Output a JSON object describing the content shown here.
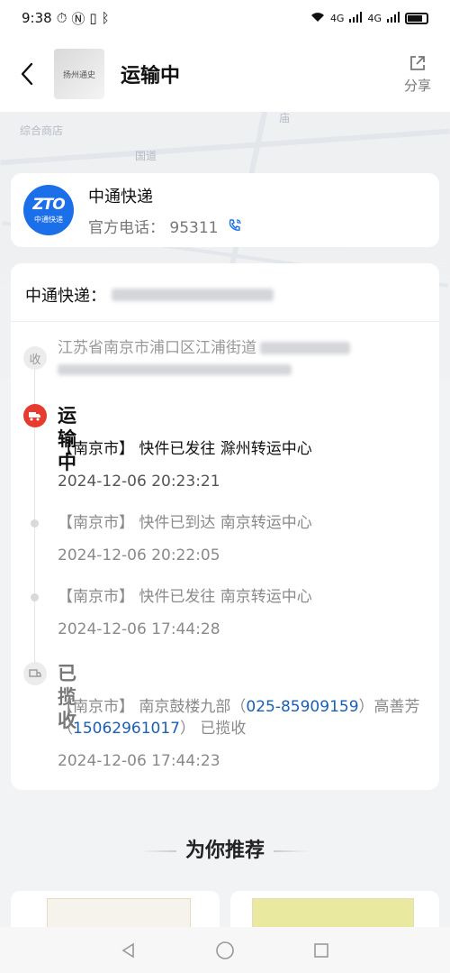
{
  "status_bar": {
    "time": "9:38",
    "network_1": "4G",
    "network_2": "4G"
  },
  "header": {
    "thumb_text": "扬州通史",
    "title": "运输中",
    "share_label": "分享"
  },
  "map": {
    "labels": [
      "综合商店",
      "国道",
      "庙"
    ]
  },
  "courier": {
    "name": "中通快递",
    "logo_big": "ZTO",
    "logo_small": "中通快递",
    "phone_label": "官方电话：",
    "phone": "95311"
  },
  "tracking": {
    "label": "中通快递：",
    "receive_badge": "收",
    "address": "江苏省南京市浦口区江浦街道",
    "status_in_transit": "运输中",
    "status_collected": "已揽收",
    "events": [
      {
        "text": "【南京市】 快件已发往 滁州转运中心",
        "time": "2024-12-06 20:23:21"
      },
      {
        "text": "【南京市】 快件已到达 南京转运中心",
        "time": "2024-12-06 20:22:05"
      },
      {
        "text": "【南京市】 快件已发往 南京转运中心",
        "time": "2024-12-06 17:44:28"
      }
    ],
    "collected_event": {
      "text_1": "【南京市】 南京鼓楼九部（",
      "phone_1": "025-85909159",
      "text_2": "）高善芳（",
      "phone_2": "15062961017",
      "text_3": "） 已揽收",
      "time": "2024-12-06 17:44:23"
    }
  },
  "recommend": {
    "title": "为你推荐"
  },
  "colors": {
    "accent_red": "#e63b2e",
    "brand_blue": "#1b6fe8",
    "link_blue": "#1b5fb5"
  }
}
